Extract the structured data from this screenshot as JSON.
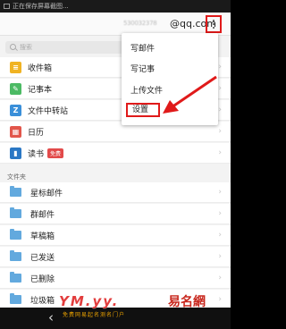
{
  "status_bar": {
    "text": "正在保存屏幕截图..."
  },
  "header": {
    "account_blurred": "530032378",
    "account_domain": "@qq.com"
  },
  "search": {
    "placeholder": "搜索"
  },
  "apps": [
    {
      "label": "收件箱",
      "color": "#f0b323"
    },
    {
      "label": "记事本",
      "color": "#4cba64"
    },
    {
      "label": "文件中转站",
      "color": "#3a8fd9"
    },
    {
      "label": "日历",
      "color": "#e2564b"
    },
    {
      "label": "读书",
      "color": "#2b78c5",
      "badge": "免费"
    }
  ],
  "section": {
    "folders_label": "文件夹"
  },
  "folders": [
    "星标邮件",
    "群邮件",
    "草稿箱",
    "已发送",
    "已删除",
    "垃圾箱"
  ],
  "menu": {
    "items": [
      "写邮件",
      "写记事",
      "上传文件"
    ],
    "settings_label": "设置"
  },
  "watermark": {
    "latin": "YM.yy.",
    "chinese": "易名網",
    "sub": "免费网易起名测名门户"
  },
  "colors": {
    "highlight": "#e01a1a",
    "folder": "#62a9de"
  }
}
